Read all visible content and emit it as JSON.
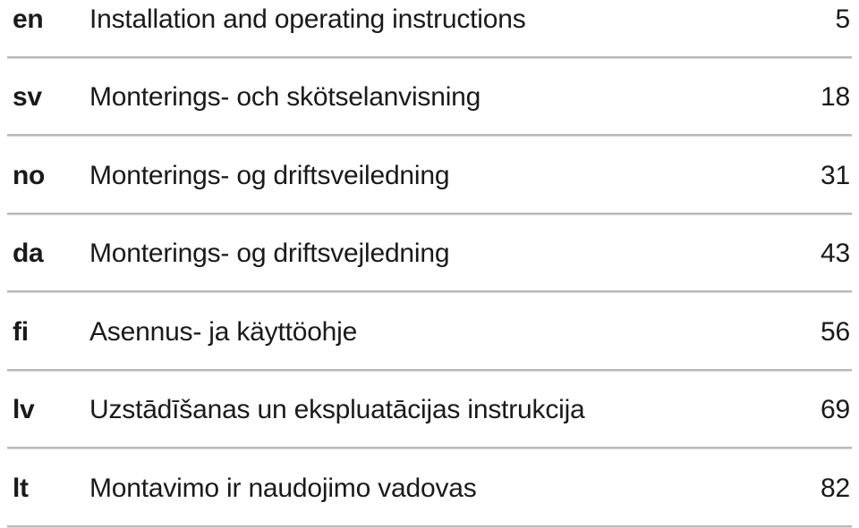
{
  "document": {
    "kind": "table-of-contents",
    "entries": [
      {
        "lang": "en",
        "title": "Installation and operating instructions",
        "page": "5"
      },
      {
        "lang": "sv",
        "title": "Monterings- och skötselanvisning",
        "page": "18"
      },
      {
        "lang": "no",
        "title": "Monterings- og driftsveiledning",
        "page": "31"
      },
      {
        "lang": "da",
        "title": "Monterings- og driftsvejledning",
        "page": "43"
      },
      {
        "lang": "fi",
        "title": "Asennus- ja käyttöohje",
        "page": "56"
      },
      {
        "lang": "lv",
        "title": "Uzstādīšanas un ekspluatācijas instrukcija",
        "page": "69"
      },
      {
        "lang": "lt",
        "title": "Montavimo ir naudojimo vadovas",
        "page": "82"
      }
    ]
  },
  "colors": {
    "text": "#1a1a1a",
    "rule": "#b9b9b9",
    "rule_shadow": "#d8d8d8",
    "background": "#ffffff"
  }
}
